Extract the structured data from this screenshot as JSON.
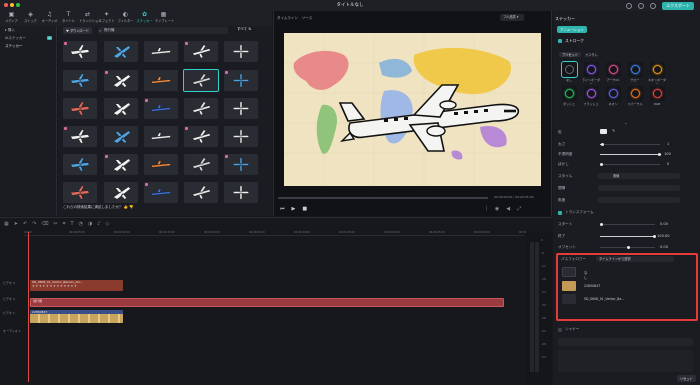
{
  "window": {
    "title": "タイトルなし",
    "export_label": "エクスポート"
  },
  "toolbar": {
    "tools": [
      {
        "icon": "media-icon",
        "glyph": "▣",
        "label": "メディア"
      },
      {
        "icon": "stock-icon",
        "glyph": "◈",
        "label": "ストック"
      },
      {
        "icon": "audio-icon",
        "glyph": "♫",
        "label": "オーディオ"
      },
      {
        "icon": "title-icon",
        "glyph": "T",
        "label": "タイトル"
      },
      {
        "icon": "transition-icon",
        "glyph": "⇄",
        "label": "トランジション"
      },
      {
        "icon": "effects-icon",
        "glyph": "✦",
        "label": "エフェクト"
      },
      {
        "icon": "filter-icon",
        "glyph": "◐",
        "label": "フィルター"
      },
      {
        "icon": "sticker-icon",
        "glyph": "✿",
        "label": "ステッカー"
      },
      {
        "icon": "template-icon",
        "glyph": "▦",
        "label": "テンプレート"
      }
    ],
    "active_index": 7
  },
  "leftnav": {
    "items": [
      {
        "label": "▸ 購入",
        "badge": ""
      },
      {
        "label": "AIステッカー",
        "badge": "AI"
      },
      {
        "label": "ステッカー",
        "badge": ""
      }
    ],
    "active_index": 2
  },
  "assets": {
    "tab_label": "♥ ダウンロード",
    "search_value": "飛行機",
    "filter_label": "すべて ⇅",
    "feedback": "これらの検索結果に満足しましたか？  👍  👎"
  },
  "preview": {
    "tab1": "タイムライン",
    "tab2": "ソース",
    "quality": "フル品質 ▾",
    "time": "00:00:00:00  |  00:00:05:00"
  },
  "inspector": {
    "tabs": [
      "ステッカー",
      "アニメーション"
    ],
    "section_stroke": "ストローク",
    "preset_label": "プリセット",
    "custom_label": "カスタム",
    "presets": [
      {
        "label": "なし",
        "color": "#666a73"
      },
      {
        "label": "ラインボーダー",
        "color": "#8b5cf6"
      },
      {
        "label": "アーク01",
        "color": "#ec4899"
      },
      {
        "label": "グロー",
        "color": "#3b82f6"
      },
      {
        "label": "ネオンボーダー",
        "color": "#f59e0b"
      },
      {
        "label": "ダッシュ",
        "color": "#22c55e"
      },
      {
        "label": "フラッシュ",
        "color": "#a855f7"
      },
      {
        "label": "ネオン",
        "color": "#6366f1"
      },
      {
        "label": "スパークル",
        "color": "#f97316"
      },
      {
        "label": "RGB",
        "color": "#ef4444"
      }
    ],
    "color_label": "色",
    "size_label": "太さ",
    "size_value": "1",
    "opacity_label": "不透明度",
    "opacity_value": "100",
    "blur_label": "ぼかし",
    "blur_value": "0",
    "style_label": "スタイル",
    "style_value": "実線",
    "spacing_label": "間隔",
    "angle_label": "角度",
    "transform_label": "トランスフォーム",
    "start_label": "スタート",
    "start_value": "0.00",
    "end_label": "終了",
    "end_value": "100.00",
    "offset_label": "オフセット",
    "offset_value": "0.00",
    "path_label": "パスフォロワー",
    "path_value": "タイムラインから選択",
    "path_items": [
      "なし",
      "22850847",
      "SD_0608_01_Vector_Ba..."
    ],
    "shadow_label": "シャドー",
    "reset_label": "リセット"
  },
  "timeline": {
    "ruler_ticks": [
      "00:00",
      "00:00:05:00",
      "00:00:10:00",
      "00:00:15:00",
      "00:00:20:00",
      "00:00:25:00",
      "00:00:30:00",
      "00:00:35:00",
      "00:00:40:00",
      "00:00:45:00",
      "00:00:50:00",
      "00:00:55:00"
    ],
    "tracks": [
      {
        "name": "ビデオ 3"
      },
      {
        "name": "ビデオ 2"
      },
      {
        "name": "ビデオ 1"
      },
      {
        "name": "オーディオ 1"
      }
    ],
    "clips": {
      "sticker_clip": "SD_0608_01_Vector_Banner_Ani...",
      "video_clip": "22850847",
      "title_clip": "飛行機"
    },
    "meter_labels": [
      "0",
      "-6",
      "-12",
      "-18",
      "-24",
      "-30",
      "-36",
      "-42",
      "-48",
      "-54"
    ]
  }
}
